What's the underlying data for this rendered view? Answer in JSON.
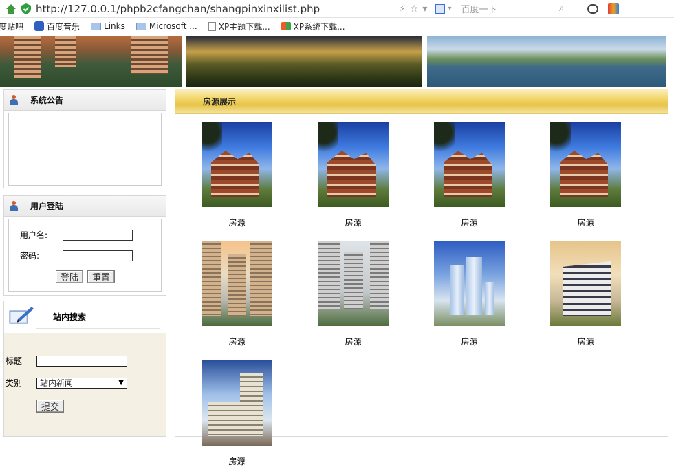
{
  "browser": {
    "url": "http://127.0.0.1/phpb2cfangchan/shangpinxinxilist.php",
    "search_placeholder": "百度一下"
  },
  "bookmarks": [
    {
      "label": "度贴吧",
      "icon": "none"
    },
    {
      "label": "百度音乐",
      "icon": "baidu-paw-icon"
    },
    {
      "label": "Links",
      "icon": "folder-icon"
    },
    {
      "label": "Microsoft ...",
      "icon": "folder-icon"
    },
    {
      "label": "XP主题下载...",
      "icon": "page-icon"
    },
    {
      "label": "XP系统下载...",
      "icon": "xp-icon"
    }
  ],
  "sidebar": {
    "notice": {
      "title": "系统公告"
    },
    "login": {
      "title": "用户登陆",
      "username_label": "用户名:",
      "password_label": "密码:",
      "login_button": "登陆",
      "reset_button": "重置"
    },
    "search": {
      "title": "站内搜索",
      "title_label": "标题",
      "category_label": "类别",
      "category_selected": "站内新闻",
      "submit_button": "提交"
    }
  },
  "main": {
    "title": "房源展示",
    "listings": [
      {
        "caption": "房源"
      },
      {
        "caption": "房源"
      },
      {
        "caption": "房源"
      },
      {
        "caption": "房源"
      },
      {
        "caption": "房源"
      },
      {
        "caption": "房源"
      },
      {
        "caption": "房源"
      },
      {
        "caption": "房源"
      },
      {
        "caption": "房源"
      }
    ]
  },
  "colors": {
    "header_gold": "#e7c44a",
    "search_panel_bg": "#f4f1e4",
    "border_gray": "#d7d7d7"
  }
}
